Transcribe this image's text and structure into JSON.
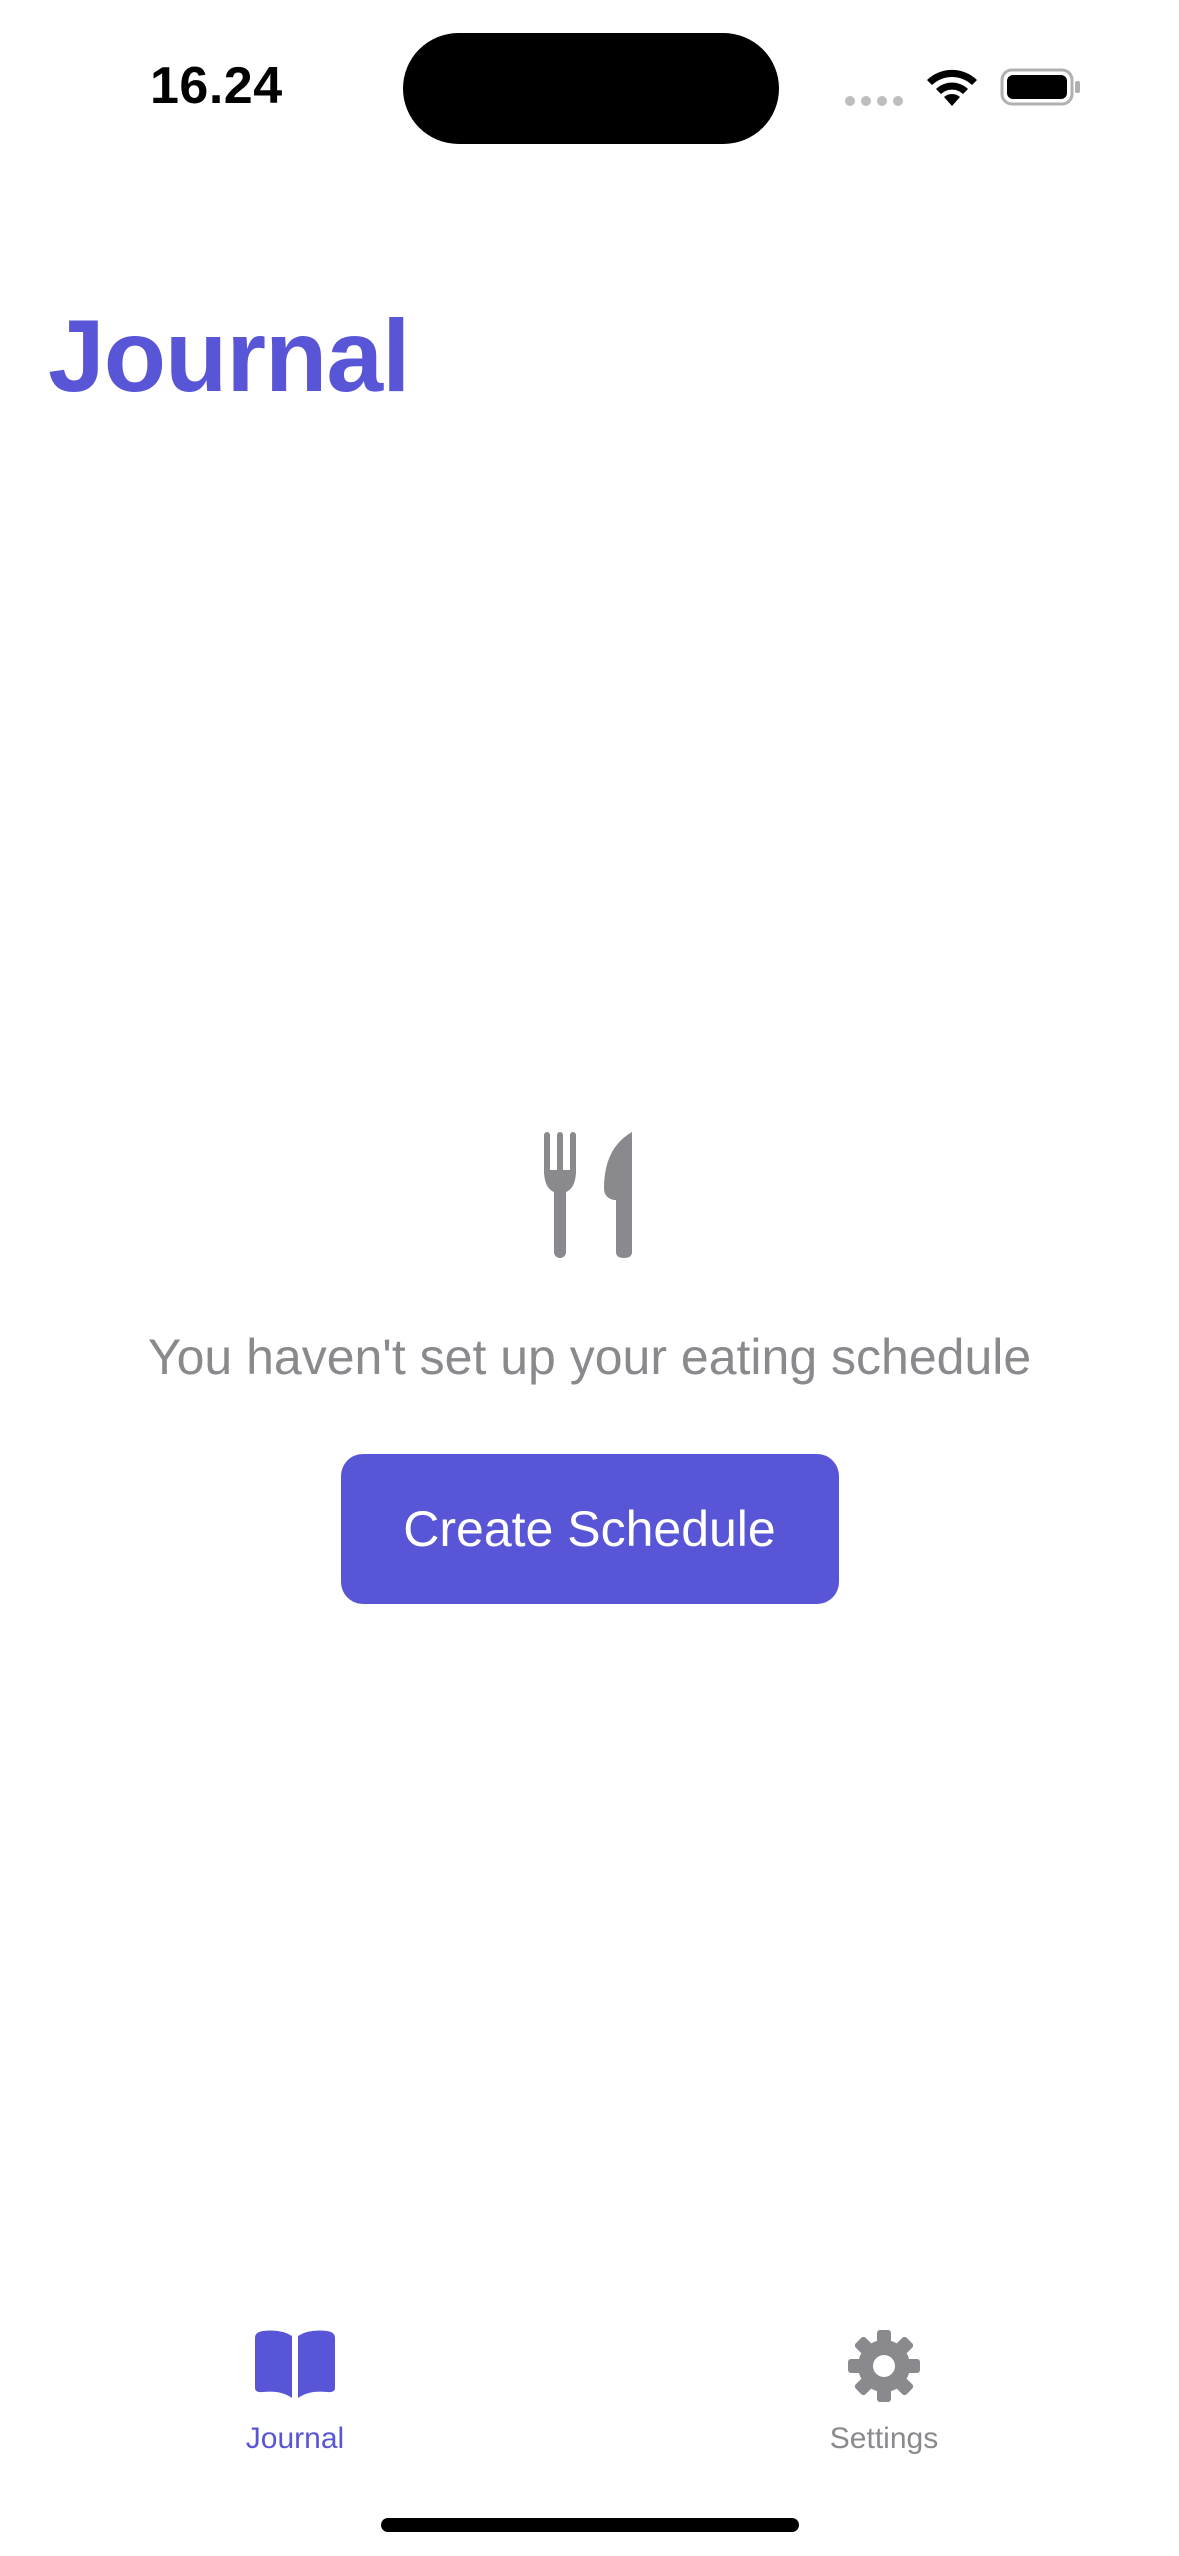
{
  "status_bar": {
    "time": "16.24"
  },
  "header": {
    "title": "Journal"
  },
  "empty_state": {
    "icon": "fork-knife-icon",
    "message": "You haven't set up your eating schedule",
    "button_label": "Create Schedule"
  },
  "tab_bar": {
    "items": [
      {
        "label": "Journal",
        "icon": "book-icon",
        "selected": true
      },
      {
        "label": "Settings",
        "icon": "gear-icon",
        "selected": false
      }
    ]
  },
  "colors": {
    "accent": "#5856d6",
    "secondary_text": "#8a8a8e",
    "background": "#ffffff"
  }
}
